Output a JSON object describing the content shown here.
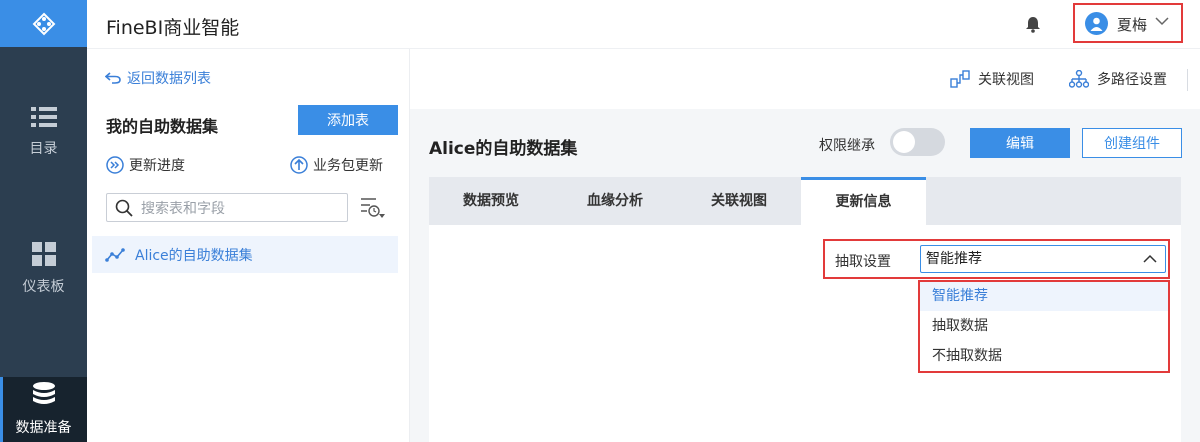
{
  "app": {
    "title": "FineBI商业智能"
  },
  "sidebar": {
    "items": [
      {
        "label": "目录",
        "icon": "list-icon"
      },
      {
        "label": "仪表板",
        "icon": "dashboard-icon"
      },
      {
        "label": "数据准备",
        "icon": "database-icon",
        "active": true
      }
    ]
  },
  "user": {
    "name": "夏梅"
  },
  "panel": {
    "back_label": "返回数据列表",
    "title": "我的自助数据集",
    "add_button": "添加表",
    "progress_label": "更新进度",
    "package_update_label": "业务包更新",
    "search_placeholder": "搜索表和字段",
    "datasets": [
      {
        "label": "Alice的自助数据集",
        "selected": true
      }
    ]
  },
  "toolbar": {
    "relation_view": "关联视图",
    "multipath_settings": "多路径设置"
  },
  "dataset": {
    "title": "Alice的自助数据集",
    "permission_inherit_label": "权限继承",
    "permission_inherit_on": false,
    "edit_button": "编辑",
    "create_component_button": "创建组件"
  },
  "tabs": [
    {
      "label": "数据预览"
    },
    {
      "label": "血缘分析"
    },
    {
      "label": "关联视图"
    },
    {
      "label": "更新信息",
      "active": true
    }
  ],
  "extract": {
    "label": "抽取设置",
    "selected": "智能推荐",
    "options": [
      "智能推荐",
      "抽取数据",
      "不抽取数据"
    ]
  },
  "colors": {
    "accent": "#3a8ee6",
    "sidebar": "#2c3e50",
    "highlight_border": "#e23a3a"
  }
}
